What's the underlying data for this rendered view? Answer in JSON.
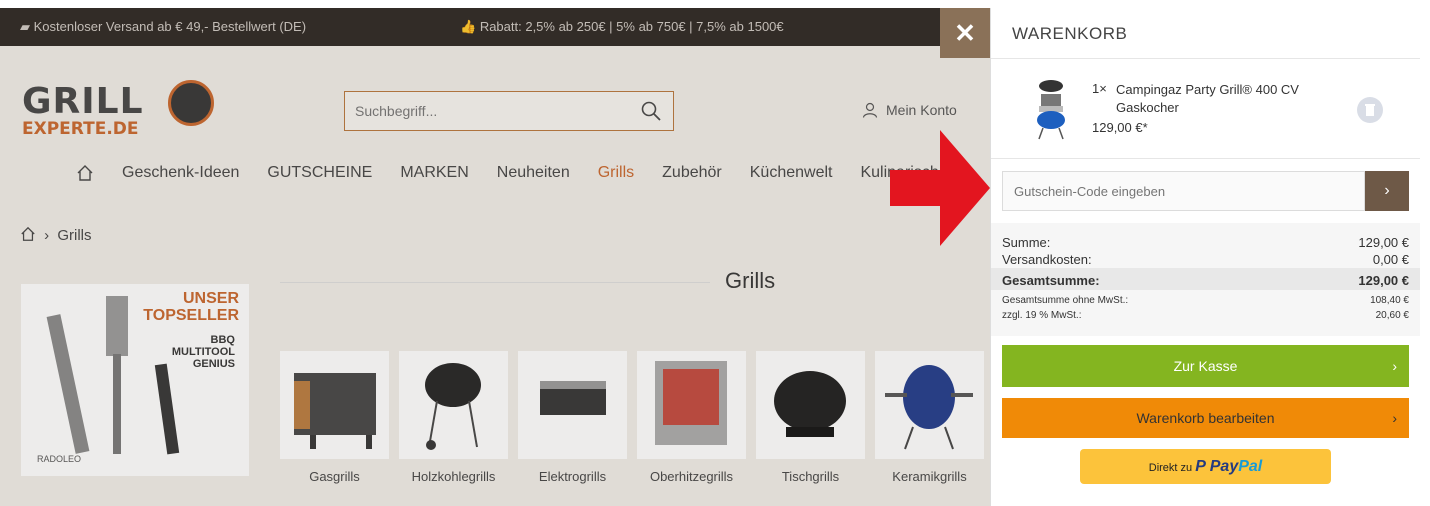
{
  "topbar": {
    "shipping": "Kostenloser Versand ab € 49,- Bestellwert (DE)",
    "discount": "Rabatt: 2,5% ab 250€ | 5% ab 750€ | 7,5% ab 1500€"
  },
  "header": {
    "logo_line1": "GRILL",
    "logo_line2": "EXPERTE.DE",
    "search_placeholder": "Suchbegriff...",
    "account_label": "Mein Konto"
  },
  "nav": {
    "items": [
      "Geschenk-Ideen",
      "GUTSCHEINE",
      "MARKEN",
      "Neuheiten",
      "Grills",
      "Zubehör",
      "Küchenwelt",
      "Kulinarisch"
    ],
    "active": "Grills"
  },
  "breadcrumb": {
    "current": "Grills"
  },
  "banner": {
    "headline": "UNSER TOPSELLER",
    "product": "BBQ MULTITOOL GENIUS",
    "brand": "RADOLEO"
  },
  "category": {
    "title": "Grills",
    "items": [
      "Gasgrills",
      "Holzkohlegrills",
      "Elektrogrills",
      "Oberhitzegrills",
      "Tischgrills",
      "Keramikgrills"
    ]
  },
  "cart": {
    "title": "WARENKORB",
    "close_icon": "close-icon",
    "item": {
      "quantity": "1×",
      "name": "Campingaz Party Grill® 400 CV Gaskocher",
      "price": "129,00 €*"
    },
    "voucher_placeholder": "Gutschein-Code eingeben",
    "summary": {
      "sum_label": "Summe:",
      "sum_value": "129,00 €",
      "shipping_label": "Versandkosten:",
      "shipping_value": "0,00 €",
      "total_label": "Gesamtsumme:",
      "total_value": "129,00 €",
      "net_label": "Gesamtsumme ohne MwSt.:",
      "net_value": "108,40 €",
      "vat_label": "zzgl. 19 % MwSt.:",
      "vat_value": "20,60 €"
    },
    "checkout_label": "Zur Kasse",
    "edit_label": "Warenkorb bearbeiten",
    "paypal_prefix": "Direkt zu",
    "paypal_brand_1": "Pay",
    "paypal_brand_2": "Pal"
  },
  "colors": {
    "accent": "#c9662b",
    "checkout": "#84b520",
    "edit": "#f08a07",
    "paypal": "#fcc33b",
    "arrow": "#e3151f"
  }
}
